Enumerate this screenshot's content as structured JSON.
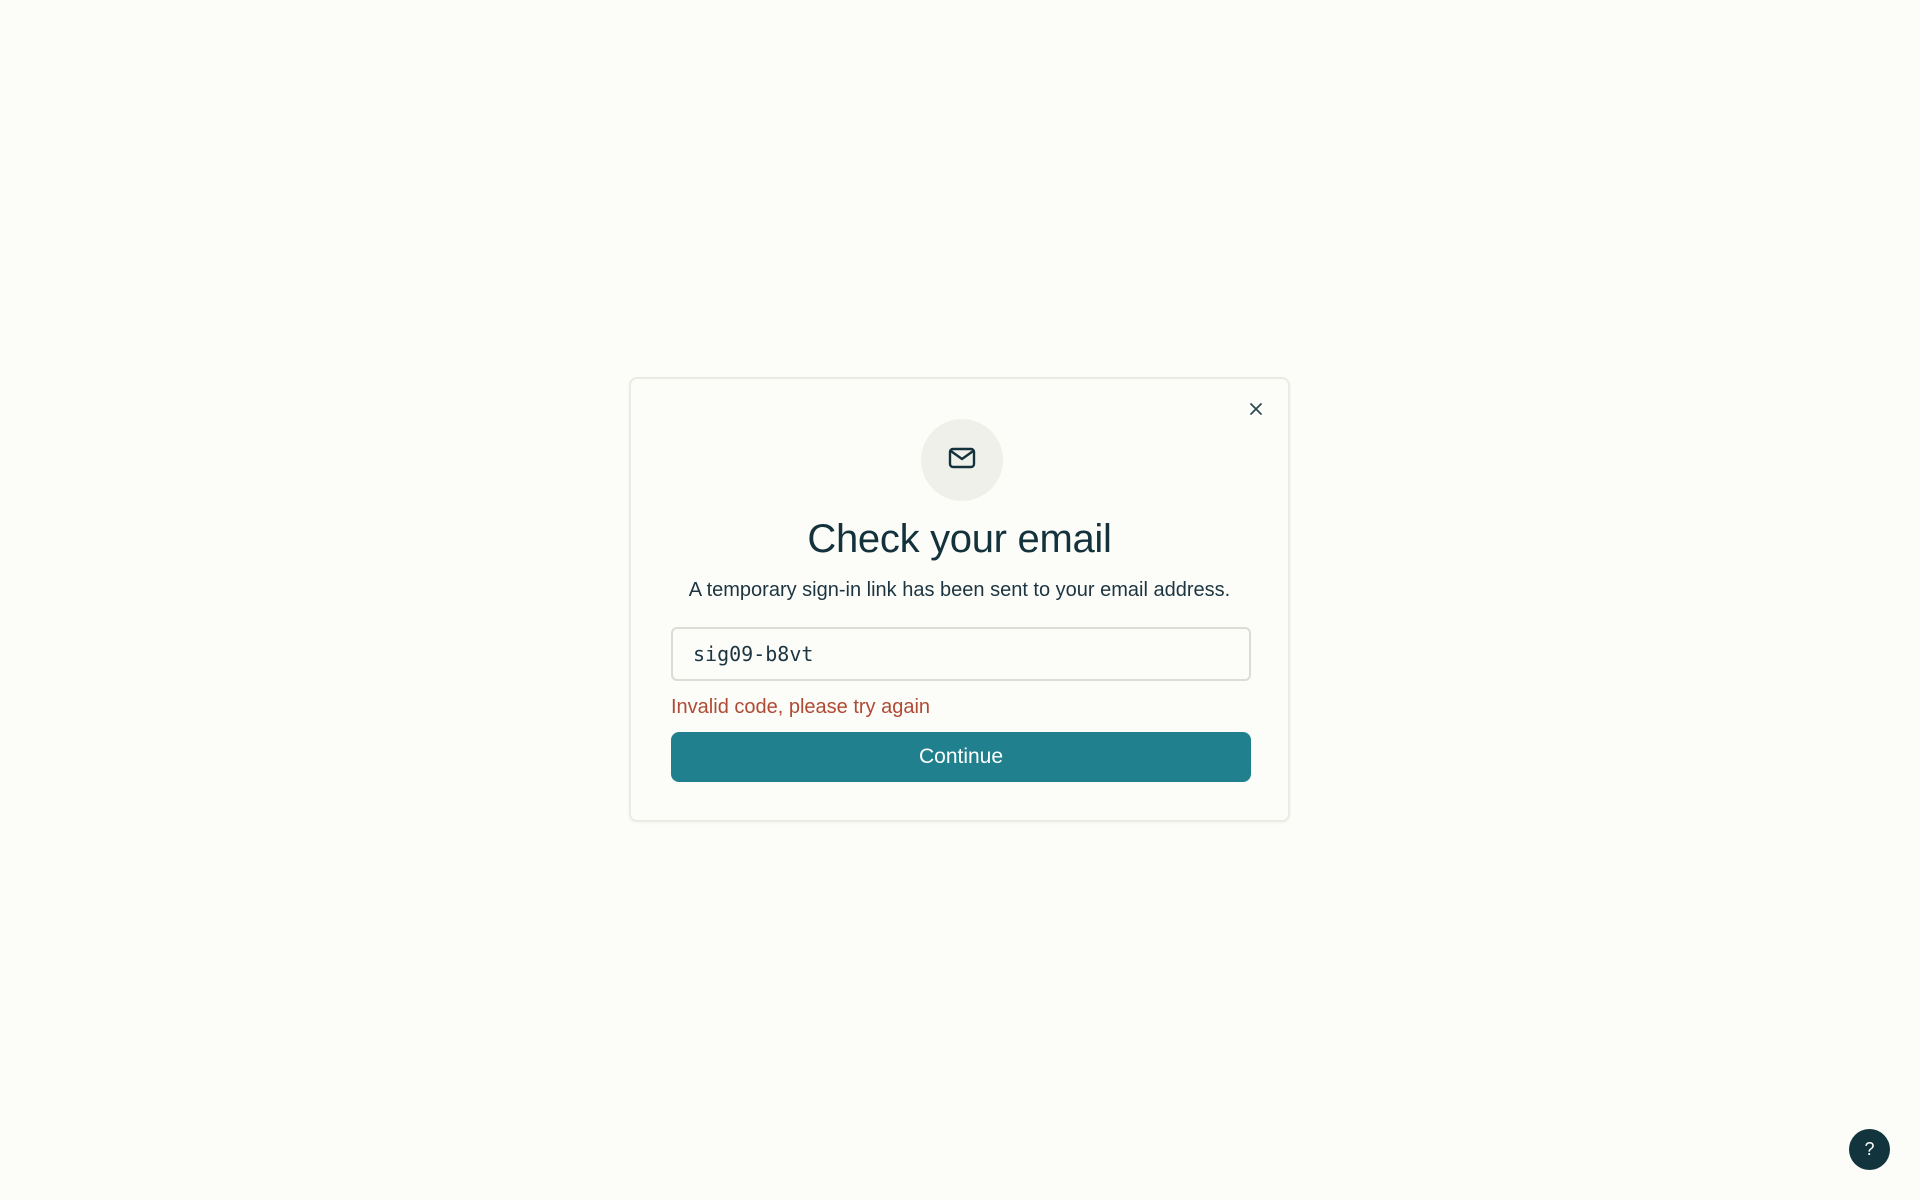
{
  "modal": {
    "title": "Check your email",
    "subtitle": "A temporary sign-in link has been sent to your email address.",
    "code_input": {
      "value": "sig09-b8vt",
      "placeholder": ""
    },
    "error_text": "Invalid code, please try again",
    "continue_label": "Continue",
    "icons": {
      "header": "mail-icon",
      "close": "close-icon"
    }
  },
  "help": {
    "label": "?"
  },
  "colors": {
    "background": "#fcfcf8",
    "primary": "#21808d",
    "title": "#14323c",
    "error": "#b04a34",
    "help_button": "#12343c"
  }
}
